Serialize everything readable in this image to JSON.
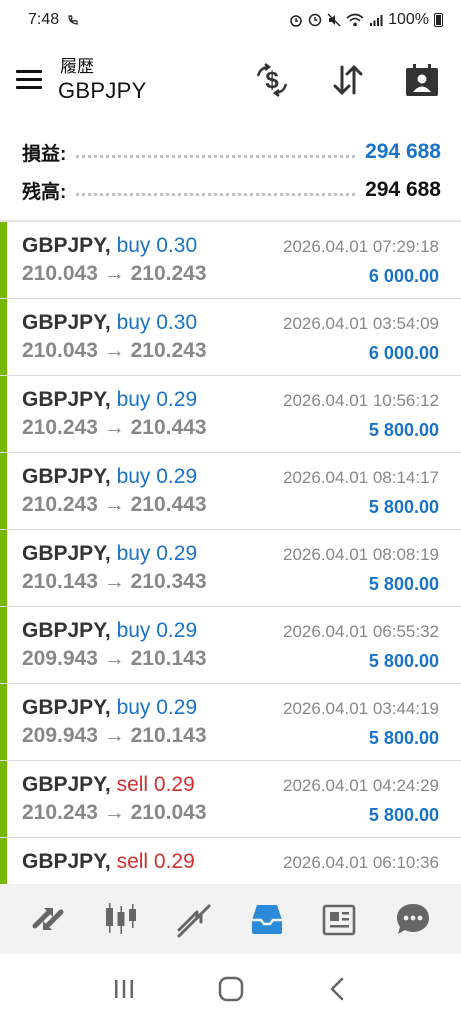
{
  "status_bar": {
    "time": "7:48",
    "battery": "100%"
  },
  "header": {
    "subtitle": "履歴",
    "symbol": "GBPJPY"
  },
  "summary": {
    "profit_label": "損益:",
    "profit_value": "294 688",
    "balance_label": "残高:",
    "balance_value": "294 688"
  },
  "colors": {
    "profit_blue": "#1a73c8",
    "buy_blue": "#1a73c8",
    "sell_red": "#d32f2f",
    "row_bar_green": "#76b900",
    "nav_active": "#2b8ad8"
  },
  "trades": [
    {
      "symbol": "GBPJPY,",
      "direction": "buy 0.30",
      "side": "buy",
      "open": "210.043",
      "arrow": "→",
      "close": "210.243",
      "time": "2026.04.01 07:29:18",
      "profit": "6 000.00"
    },
    {
      "symbol": "GBPJPY,",
      "direction": "buy 0.30",
      "side": "buy",
      "open": "210.043",
      "arrow": "→",
      "close": "210.243",
      "time": "2026.04.01 03:54:09",
      "profit": "6 000.00"
    },
    {
      "symbol": "GBPJPY,",
      "direction": "buy 0.29",
      "side": "buy",
      "open": "210.243",
      "arrow": "→",
      "close": "210.443",
      "time": "2026.04.01 10:56:12",
      "profit": "5 800.00"
    },
    {
      "symbol": "GBPJPY,",
      "direction": "buy 0.29",
      "side": "buy",
      "open": "210.243",
      "arrow": "→",
      "close": "210.443",
      "time": "2026.04.01 08:14:17",
      "profit": "5 800.00"
    },
    {
      "symbol": "GBPJPY,",
      "direction": "buy 0.29",
      "side": "buy",
      "open": "210.143",
      "arrow": "→",
      "close": "210.343",
      "time": "2026.04.01 08:08:19",
      "profit": "5 800.00"
    },
    {
      "symbol": "GBPJPY,",
      "direction": "buy 0.29",
      "side": "buy",
      "open": "209.943",
      "arrow": "→",
      "close": "210.143",
      "time": "2026.04.01 06:55:32",
      "profit": "5 800.00"
    },
    {
      "symbol": "GBPJPY,",
      "direction": "buy 0.29",
      "side": "buy",
      "open": "209.943",
      "arrow": "→",
      "close": "210.143",
      "time": "2026.04.01 03:44:19",
      "profit": "5 800.00"
    },
    {
      "symbol": "GBPJPY,",
      "direction": "sell 0.29",
      "side": "sell",
      "open": "210.243",
      "arrow": "→",
      "close": "210.043",
      "time": "2026.04.01 04:24:29",
      "profit": "5 800.00"
    },
    {
      "symbol": "GBPJPY,",
      "direction": "sell 0.29",
      "side": "sell",
      "open": "",
      "arrow": "",
      "close": "",
      "time": "2026.04.01 06:10:36",
      "profit": ""
    }
  ],
  "bottom_nav": [
    {
      "icon": "quotes-icon",
      "active": false
    },
    {
      "icon": "chart-candles-icon",
      "active": false
    },
    {
      "icon": "trade-icon",
      "active": false
    },
    {
      "icon": "history-inbox-icon",
      "active": true
    },
    {
      "icon": "news-icon",
      "active": false
    },
    {
      "icon": "chat-icon",
      "active": false
    }
  ],
  "system_nav": [
    {
      "icon": "recents-icon"
    },
    {
      "icon": "home-icon"
    },
    {
      "icon": "back-icon"
    }
  ]
}
